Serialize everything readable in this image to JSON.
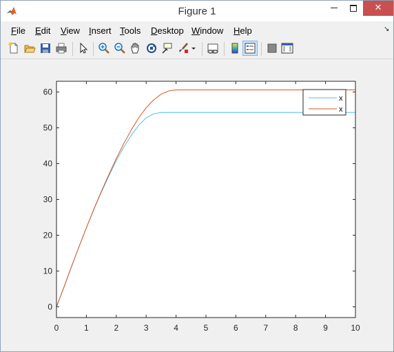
{
  "window": {
    "title": "Figure 1",
    "close_glyph": "✕"
  },
  "menu": {
    "items": [
      {
        "label": "File",
        "key": "F",
        "rest": "ile"
      },
      {
        "label": "Edit",
        "key": "E",
        "rest": "dit"
      },
      {
        "label": "View",
        "key": "V",
        "rest": "iew"
      },
      {
        "label": "Insert",
        "key": "I",
        "rest": "nsert"
      },
      {
        "label": "Tools",
        "key": "T",
        "rest": "ools"
      },
      {
        "label": "Desktop",
        "key": "D",
        "rest": "esktop"
      },
      {
        "label": "Window",
        "key": "W",
        "rest": "indow"
      },
      {
        "label": "Help",
        "key": "H",
        "rest": "elp"
      }
    ],
    "dock_glyph": "↘"
  },
  "toolbar": {
    "icons": [
      "new-figure-icon",
      "open-file-icon",
      "save-icon",
      "print-icon",
      "pointer-icon",
      "zoom-in-icon",
      "zoom-out-icon",
      "pan-icon",
      "rotate-3d-icon",
      "data-cursor-icon",
      "brush-icon",
      "link-plot-icon",
      "colorbar-icon",
      "legend-icon",
      "hide-plot-tools-icon",
      "show-plot-tools-icon"
    ],
    "active": "legend-icon"
  },
  "chart_data": {
    "type": "line",
    "xlim": [
      0,
      10
    ],
    "ylim": [
      -3,
      63
    ],
    "xticks": [
      "0",
      "1",
      "2",
      "3",
      "4",
      "5",
      "6",
      "7",
      "8",
      "9",
      "10"
    ],
    "yticks": [
      "0",
      "10",
      "20",
      "30",
      "40",
      "50",
      "60"
    ],
    "grid": false,
    "legend_placement": "top-right",
    "series": [
      {
        "name": "x",
        "color": "#4DBEEE",
        "x": [
          0,
          0.25,
          0.5,
          0.75,
          1,
          1.25,
          1.5,
          1.75,
          2,
          2.25,
          2.5,
          2.75,
          3,
          3.25,
          3.5,
          4,
          5,
          6,
          7,
          8,
          9,
          10
        ],
        "y": [
          0,
          5.5,
          11.2,
          16.7,
          22.1,
          27.2,
          32.0,
          36.5,
          40.8,
          44.6,
          47.9,
          50.7,
          52.8,
          53.9,
          54.3,
          54.3,
          54.3,
          54.3,
          54.3,
          54.3,
          54.3,
          54.3
        ]
      },
      {
        "name": "x",
        "color": "#D95319",
        "x": [
          0,
          0.25,
          0.5,
          0.75,
          1,
          1.25,
          1.5,
          1.75,
          2,
          2.25,
          2.5,
          2.75,
          3,
          3.25,
          3.5,
          3.75,
          4,
          5,
          6,
          7,
          8,
          9,
          10
        ],
        "y": [
          0,
          5.5,
          11.2,
          16.7,
          22.1,
          27.3,
          32.2,
          36.9,
          41.4,
          45.6,
          49.4,
          52.8,
          55.6,
          57.8,
          59.4,
          60.3,
          60.6,
          60.6,
          60.6,
          60.6,
          60.6,
          60.6,
          60.6
        ]
      }
    ]
  }
}
